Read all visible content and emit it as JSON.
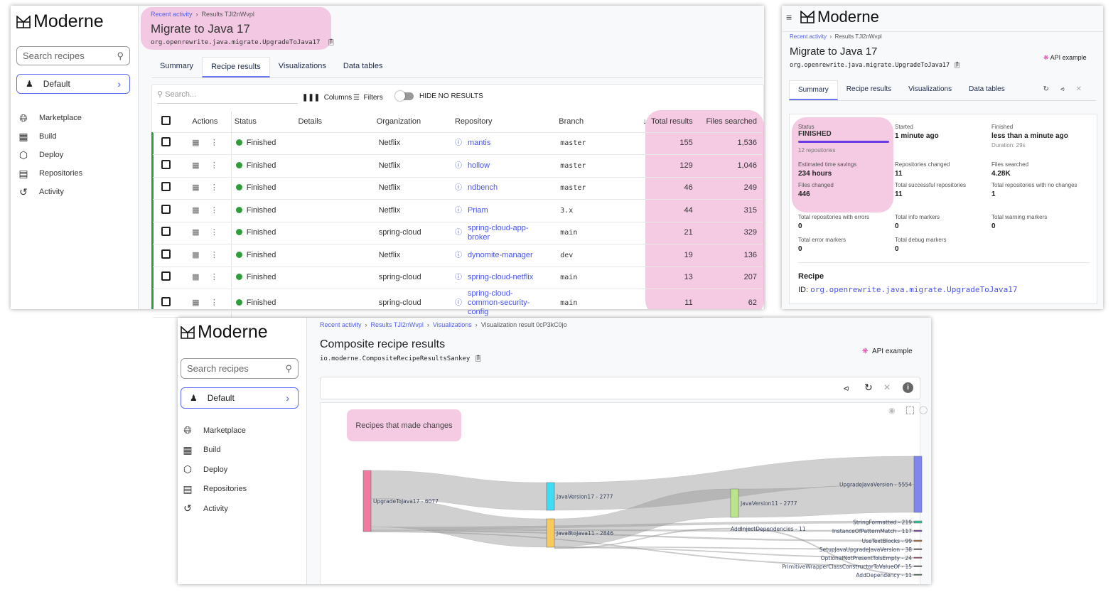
{
  "brand": "Moderne",
  "colors": {
    "accent": "#5b63ea",
    "success": "#2e9d3a",
    "highlight": "#f0b8d8",
    "progress": "#6a3be4"
  },
  "panel_a": {
    "search_placeholder": "Search recipes",
    "default_label": "Default",
    "nav": [
      {
        "label": "Marketplace",
        "icon": "globe-icon"
      },
      {
        "label": "Build",
        "icon": "grid-icon"
      },
      {
        "label": "Deploy",
        "icon": "cube-icon"
      },
      {
        "label": "Repositories",
        "icon": "book-icon"
      },
      {
        "label": "Activity",
        "icon": "history-icon"
      }
    ],
    "breadcrumb": [
      "Recent activity",
      "Results TJl2nWvpl"
    ],
    "title": "Migrate to Java 17",
    "recipe_id": "org.openrewrite.java.migrate.UpgradeToJava17",
    "tabs": [
      "Summary",
      "Recipe results",
      "Visualizations",
      "Data tables"
    ],
    "active_tab": "Recipe results",
    "table_search_placeholder": "Search...",
    "columns_label": "Columns",
    "filters_label": "Filters",
    "hide_label": "HIDE NO RESULTS",
    "headers": [
      "Actions",
      "Status",
      "Details",
      "Organization",
      "Repository",
      "Branch",
      "Total results",
      "Files searched"
    ],
    "rows": [
      {
        "status": "Finished",
        "org": "Netflix",
        "repo": "mantis",
        "branch": "master",
        "total": "155",
        "files": "1,536"
      },
      {
        "status": "Finished",
        "org": "Netflix",
        "repo": "hollow",
        "branch": "master",
        "total": "129",
        "files": "1,046"
      },
      {
        "status": "Finished",
        "org": "Netflix",
        "repo": "ndbench",
        "branch": "master",
        "total": "46",
        "files": "249"
      },
      {
        "status": "Finished",
        "org": "Netflix",
        "repo": "Priam",
        "branch": "3.x",
        "total": "44",
        "files": "315"
      },
      {
        "status": "Finished",
        "org": "spring-cloud",
        "repo": "spring-cloud-app-broker",
        "branch": "main",
        "total": "21",
        "files": "329"
      },
      {
        "status": "Finished",
        "org": "Netflix",
        "repo": "dynomite-manager",
        "branch": "dev",
        "total": "19",
        "files": "136"
      },
      {
        "status": "Finished",
        "org": "spring-cloud",
        "repo": "spring-cloud-netflix",
        "branch": "main",
        "total": "13",
        "files": "207"
      },
      {
        "status": "Finished",
        "org": "spring-cloud",
        "repo": "spring-cloud-common-security-config",
        "branch": "main",
        "total": "11",
        "files": "62"
      }
    ]
  },
  "panel_b": {
    "breadcrumb": [
      "Recent activity",
      "Results TJl2nWvpl"
    ],
    "title": "Migrate to Java 17",
    "recipe_id": "org.openrewrite.java.migrate.UpgradeToJava17",
    "api_example": "API example",
    "tabs": [
      "Summary",
      "Recipe results",
      "Visualizations",
      "Data tables"
    ],
    "status_label": "Status",
    "status": "FINISHED",
    "progress": 1.0,
    "repos": "12 repositories",
    "stats": [
      {
        "label": "Started",
        "value": "1 minute ago"
      },
      {
        "label": "Finished",
        "value": "less than a minute ago",
        "sub": "Duration: 29s"
      },
      {
        "label": "Estimated time savings",
        "value": "234 hours"
      },
      {
        "label": "Files changed",
        "value": "446"
      },
      {
        "label": "Repositories changed",
        "value": "11"
      },
      {
        "label": "Total successful repositories",
        "value": "11"
      },
      {
        "label": "Files searched",
        "value": "4.28K"
      },
      {
        "label": "Total repositories with no changes",
        "value": "1"
      },
      {
        "label": "Total repositories with errors",
        "value": "0"
      },
      {
        "label": "Total info markers",
        "value": "0"
      },
      {
        "label": "Total warning markers",
        "value": "0"
      },
      {
        "label": "Total error markers",
        "value": "0"
      },
      {
        "label": "Total debug markers",
        "value": "0"
      }
    ],
    "recipe_heading": "Recipe",
    "recipe_id_label": "ID:"
  },
  "panel_c": {
    "search_placeholder": "Search recipes",
    "default_label": "Default",
    "nav": [
      {
        "label": "Marketplace"
      },
      {
        "label": "Build"
      },
      {
        "label": "Deploy"
      },
      {
        "label": "Repositories"
      },
      {
        "label": "Activity"
      }
    ],
    "breadcrumb": [
      "Recent activity",
      "Results TJl2nWvpl",
      "Visualizations",
      "Visualization result 0cP3kC0jo"
    ],
    "title": "Composite recipe results",
    "recipe_id": "io.moderne.CompositeRecipeResultsSankey",
    "api_example": "API example",
    "annotation": "Recipes that made changes"
  },
  "chart_data": {
    "type": "sankey",
    "nodes": [
      {
        "name": "UpgradeToJava17",
        "value": 6077,
        "color": "#f07aa0"
      },
      {
        "name": "JavaVersion17",
        "value": 2777,
        "color": "#3fdcf5"
      },
      {
        "name": "Java8toJava11",
        "value": 2846,
        "color": "#f8c95c"
      },
      {
        "name": "JavaVersion11",
        "value": 2777,
        "color": "#b9e68a"
      },
      {
        "name": "UpgradeJavaVersion",
        "value": 5554,
        "color": "#7f86f0"
      },
      {
        "name": "StringFormatted",
        "value": 219,
        "color": "#2fc49a"
      },
      {
        "name": "InstanceOfPatternMatch",
        "value": 117,
        "color": "#7b4aa8"
      },
      {
        "name": "UseTextBlocks",
        "value": 99,
        "color": "#a0744a"
      },
      {
        "name": "SetupJavaUpgradeJavaVersion",
        "value": 38,
        "color": "#555555"
      },
      {
        "name": "OptionalNotPresentToIsEmpty",
        "value": 24,
        "color": "#a05070"
      },
      {
        "name": "PrimitiveWrapperClassConstructorToValueOf",
        "value": 15,
        "color": "#555555"
      },
      {
        "name": "AddDependency",
        "value": 11,
        "color": "#4a6a5a"
      },
      {
        "name": "AddInjectDependencies",
        "value": 11,
        "color": "#555555"
      }
    ],
    "links": [
      {
        "source": "UpgradeToJava17",
        "target": "JavaVersion17",
        "value": 2777
      },
      {
        "source": "UpgradeToJava17",
        "target": "Java8toJava11",
        "value": 2846
      },
      {
        "source": "UpgradeToJava17",
        "target": "StringFormatted",
        "value": 219
      },
      {
        "source": "UpgradeToJava17",
        "target": "InstanceOfPatternMatch",
        "value": 117
      },
      {
        "source": "UpgradeToJava17",
        "target": "UseTextBlocks",
        "value": 99
      },
      {
        "source": "UpgradeToJava17",
        "target": "PrimitiveWrapperClassConstructorToValueOf",
        "value": 15
      },
      {
        "source": "JavaVersion17",
        "target": "UpgradeJavaVersion",
        "value": 2777
      },
      {
        "source": "Java8toJava11",
        "target": "JavaVersion11",
        "value": 2777
      },
      {
        "source": "Java8toJava11",
        "target": "SetupJavaUpgradeJavaVersion",
        "value": 38
      },
      {
        "source": "Java8toJava11",
        "target": "OptionalNotPresentToIsEmpty",
        "value": 24
      },
      {
        "source": "Java8toJava11",
        "target": "AddInjectDependencies",
        "value": 11
      },
      {
        "source": "JavaVersion11",
        "target": "UpgradeJavaVersion",
        "value": 2777
      },
      {
        "source": "AddInjectDependencies",
        "target": "AddDependency",
        "value": 11
      }
    ]
  }
}
